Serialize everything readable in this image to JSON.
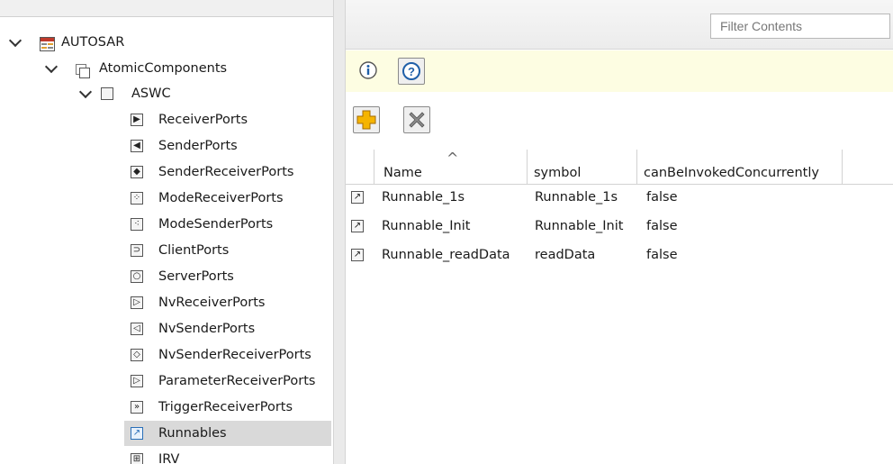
{
  "tree": {
    "root": {
      "label": "AUTOSAR",
      "icon": "autosar-icon"
    },
    "atomic": {
      "label": "AtomicComponents",
      "icon": "folder-icon"
    },
    "aswc": {
      "label": "ASWC",
      "icon": "component-icon"
    },
    "items": [
      {
        "label": "ReceiverPorts",
        "icon": "receiver-port-icon",
        "glyph": "▶"
      },
      {
        "label": "SenderPorts",
        "icon": "sender-port-icon",
        "glyph": "◀"
      },
      {
        "label": "SenderReceiverPorts",
        "icon": "sender-receiver-port-icon",
        "glyph": "◆"
      },
      {
        "label": "ModeReceiverPorts",
        "icon": "mode-receiver-port-icon",
        "glyph": "⁘"
      },
      {
        "label": "ModeSenderPorts",
        "icon": "mode-sender-port-icon",
        "glyph": "⁖"
      },
      {
        "label": "ClientPorts",
        "icon": "client-port-icon",
        "glyph": "⊃"
      },
      {
        "label": "ServerPorts",
        "icon": "server-port-icon",
        "glyph": "○"
      },
      {
        "label": "NvReceiverPorts",
        "icon": "nv-receiver-port-icon",
        "glyph": "▷"
      },
      {
        "label": "NvSenderPorts",
        "icon": "nv-sender-port-icon",
        "glyph": "◁"
      },
      {
        "label": "NvSenderReceiverPorts",
        "icon": "nv-sender-receiver-port-icon",
        "glyph": "◇"
      },
      {
        "label": "ParameterReceiverPorts",
        "icon": "parameter-receiver-port-icon",
        "glyph": "▷"
      },
      {
        "label": "TriggerReceiverPorts",
        "icon": "trigger-receiver-port-icon",
        "glyph": "»"
      },
      {
        "label": "Runnables",
        "icon": "runnable-icon",
        "glyph": "↗",
        "selected": true
      },
      {
        "label": "IRV",
        "icon": "irv-icon",
        "glyph": "⊞"
      }
    ]
  },
  "filter": {
    "placeholder": "Filter Contents"
  },
  "help": {
    "info_icon": "info-icon",
    "help_icon": "help-icon"
  },
  "toolbar": {
    "add_icon": "add-icon",
    "delete_icon": "delete-icon"
  },
  "table": {
    "columns": [
      "Name",
      "symbol",
      "canBeInvokedConcurrently"
    ],
    "sort_indicator": "^",
    "rows": [
      {
        "name": "Runnable_1s",
        "symbol": "Runnable_1s",
        "concurrent": "false"
      },
      {
        "name": "Runnable_Init",
        "symbol": "Runnable_Init",
        "concurrent": "false"
      },
      {
        "name": "Runnable_readData",
        "symbol": "readData",
        "concurrent": "false"
      }
    ]
  },
  "colors": {
    "selection": "#d9d9d9",
    "help_strip": "#fdfde2",
    "add_icon": "#f5b400",
    "delete_icon": "#8a8a8a",
    "help_icon_blue": "#1f5fa8"
  }
}
